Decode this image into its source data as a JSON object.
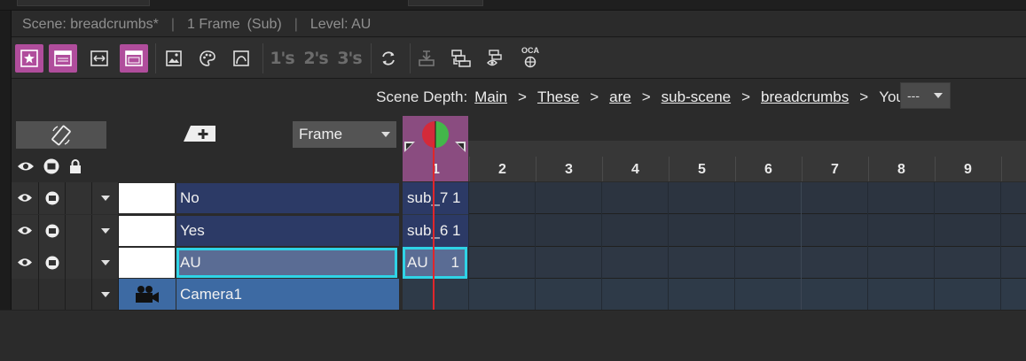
{
  "status": {
    "scene": "Scene: breadcrumbs*",
    "frames": "1 Frame",
    "sub": "(Sub)",
    "level": "Level: AU",
    "sep": "|"
  },
  "toolbar": {
    "btn_1s": "1's",
    "btn_2s": "2's",
    "btn_3s": "3's",
    "oca": "OCA"
  },
  "depth": {
    "label": "Scene Depth:",
    "crumbs": [
      "Main",
      "These",
      "are",
      "sub-scene",
      "breadcrumbs"
    ],
    "gt": ">",
    "tail": "You like?",
    "pipe": "|",
    "select_value": "---"
  },
  "header": {
    "frame_select": "Frame"
  },
  "ruler": {
    "frames": [
      "1",
      "2",
      "3",
      "4",
      "5",
      "6",
      "7",
      "8",
      "9"
    ]
  },
  "layers": [
    {
      "name": "No",
      "cell": "sub_7 1",
      "color": "#2c3a66"
    },
    {
      "name": "Yes",
      "cell": "sub_6 1",
      "color": "#2c3a66"
    },
    {
      "name": "AU",
      "cell_name": "AU",
      "cell_frame": "1",
      "color": "#5a6c94"
    },
    {
      "name": "Camera1",
      "color": "#3d6aa3"
    }
  ],
  "colors": {
    "accent": "#b04d9c",
    "selection": "#2fd3e6",
    "current_frame": "#8a4c80",
    "playhead": "#e0262b"
  }
}
